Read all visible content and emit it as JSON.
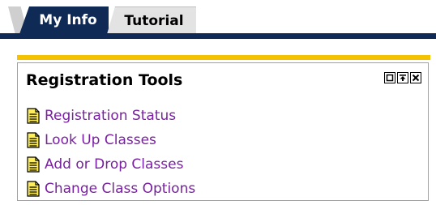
{
  "tabs": [
    {
      "label": "My Info",
      "active": true
    },
    {
      "label": "Tutorial",
      "active": false
    }
  ],
  "portlet": {
    "title": "Registration Tools",
    "controls": [
      "restore-icon",
      "maximize-icon",
      "close-icon"
    ],
    "links": [
      {
        "label": "Registration Status",
        "icon": "document-icon"
      },
      {
        "label": "Look Up Classes",
        "icon": "document-icon"
      },
      {
        "label": "Add or Drop Classes",
        "icon": "document-icon"
      },
      {
        "label": "Change Class Options",
        "icon": "document-icon"
      }
    ]
  },
  "colors": {
    "tab_active_bg": "#0f2a55",
    "tab_inactive_bg": "#e3e3e3",
    "accent_bar": "#f5c200",
    "link": "#7a1fa2"
  }
}
